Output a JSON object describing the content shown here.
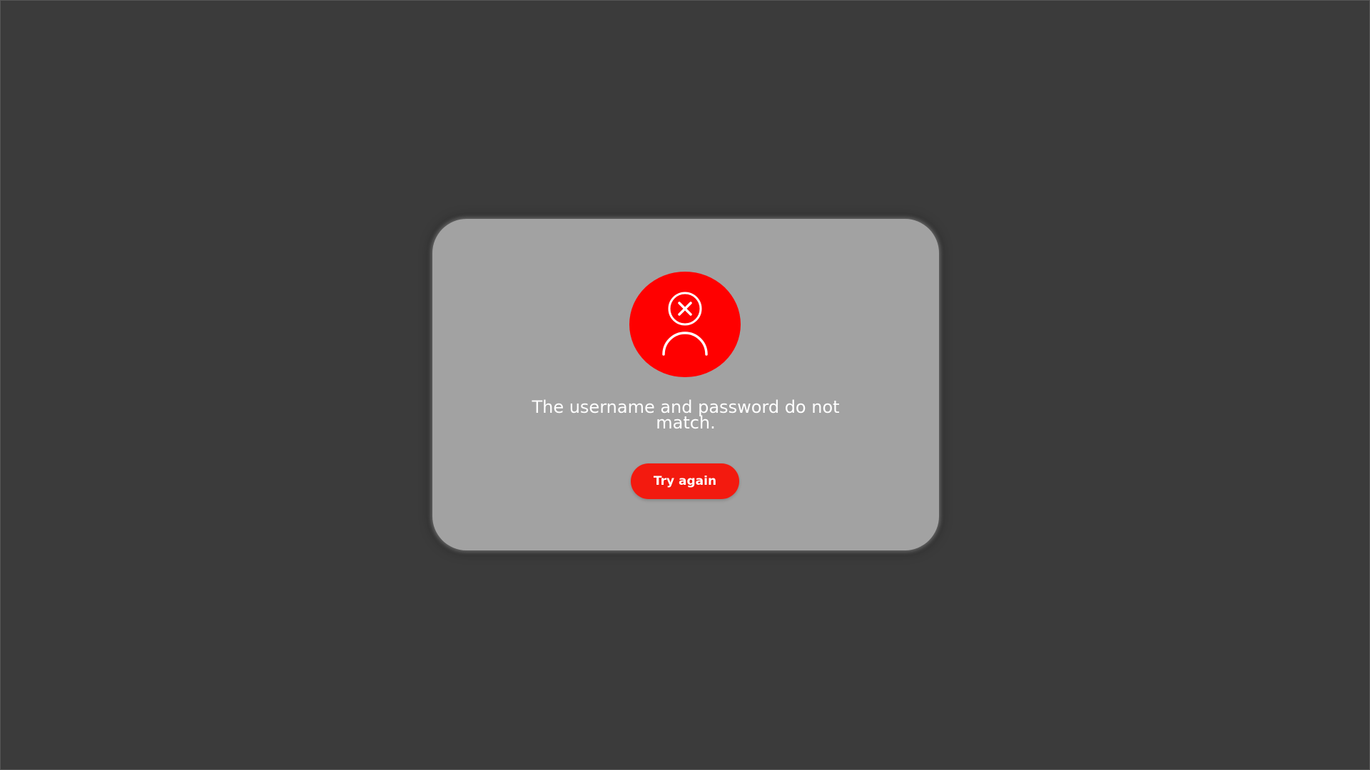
{
  "dialog": {
    "icon": "user-error-icon",
    "message": "The username and password do not match.",
    "primary_button_label": "Try again"
  },
  "colors": {
    "background": "#3b3b3b",
    "dialog_background": "#a2a2a2",
    "icon_circle": "#ff0000",
    "button": "#f31a0f",
    "text": "#ffffff"
  }
}
